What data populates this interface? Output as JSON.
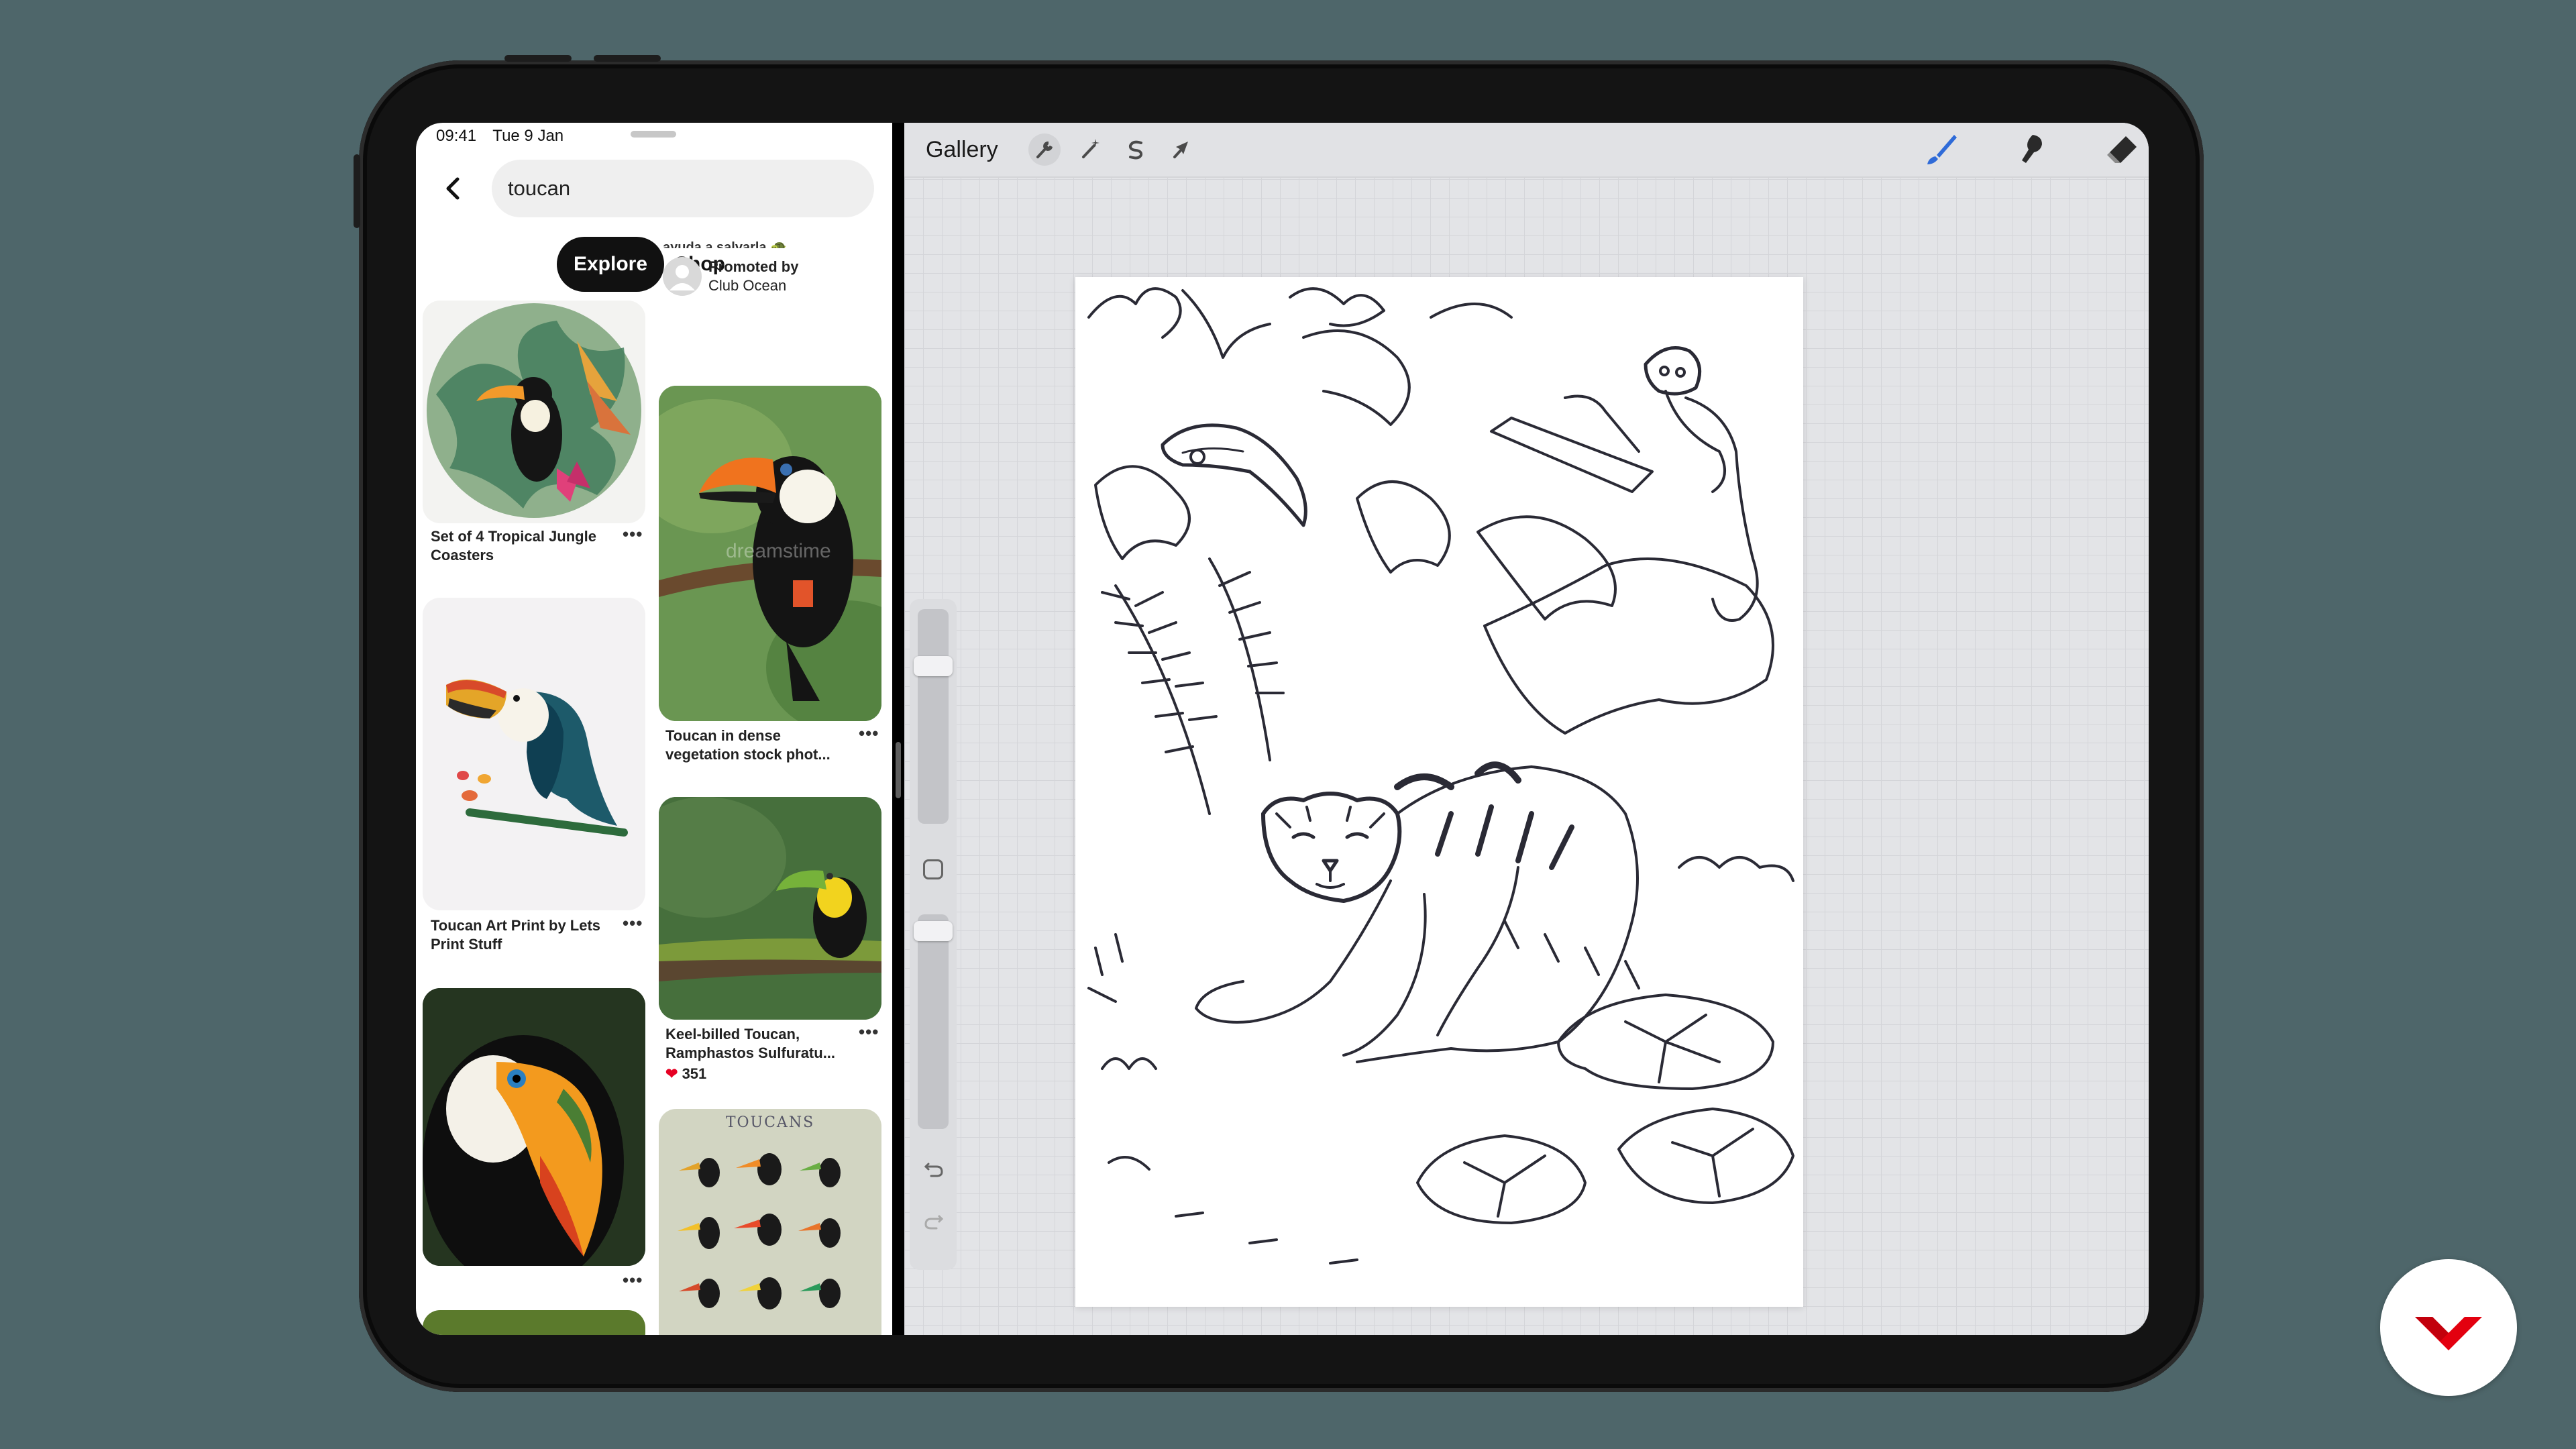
{
  "status_bar": {
    "time": "09:41",
    "date": "Tue 9 Jan"
  },
  "pinterest": {
    "search": {
      "query": "toucan"
    },
    "tabs": [
      {
        "label": "Explore",
        "active": true
      },
      {
        "label": "Shop",
        "active": false
      }
    ],
    "promoted": {
      "truncated_text": "ayuda a salvarla 🐢",
      "promoted_by_label": "Promoted by",
      "advertiser": "Club Ocean"
    },
    "pins_left": [
      {
        "caption_line1": "Set of 4 Tropical Jungle",
        "caption_line2": "Coasters"
      },
      {
        "caption_line1": "Toucan Art Print by Lets",
        "caption_line2": "Print Stuff"
      },
      {
        "caption_line1": "",
        "caption_line2": ""
      }
    ],
    "pins_right": [
      {
        "caption_line1": "Toucan in dense",
        "caption_line2": "vegetation stock phot...",
        "watermark": "dreamstime"
      },
      {
        "caption_line1": "Keel-billed Toucan,",
        "caption_line2": "Ramphastos Sulfuratu...",
        "saves": "351"
      },
      {
        "poster_title": "TOUCANS"
      }
    ],
    "more_label": "•••"
  },
  "procreate": {
    "gallery_label": "Gallery",
    "tools_left": [
      "wrench-icon",
      "magic-wand-icon",
      "selection-icon",
      "transform-arrow-icon"
    ],
    "tools_right": [
      "brush-icon",
      "smudge-icon",
      "eraser-icon",
      "layers-icon",
      "color-icon"
    ],
    "active_tool": "brush",
    "active_tool_color": "#2f6bd8",
    "current_color": "#2c2d3a",
    "sidebar": {
      "brush_size_level": 0.92,
      "opacity_level": 0.97
    },
    "sketch": {
      "subjects": [
        "tiger",
        "toucan",
        "monkey",
        "jungle leaves",
        "lily pads"
      ],
      "stroke_color": "#2a2a35"
    }
  },
  "colors": {
    "background": "#4e666a",
    "pin_red": "#e60023",
    "logo_red": "#e3000f"
  }
}
